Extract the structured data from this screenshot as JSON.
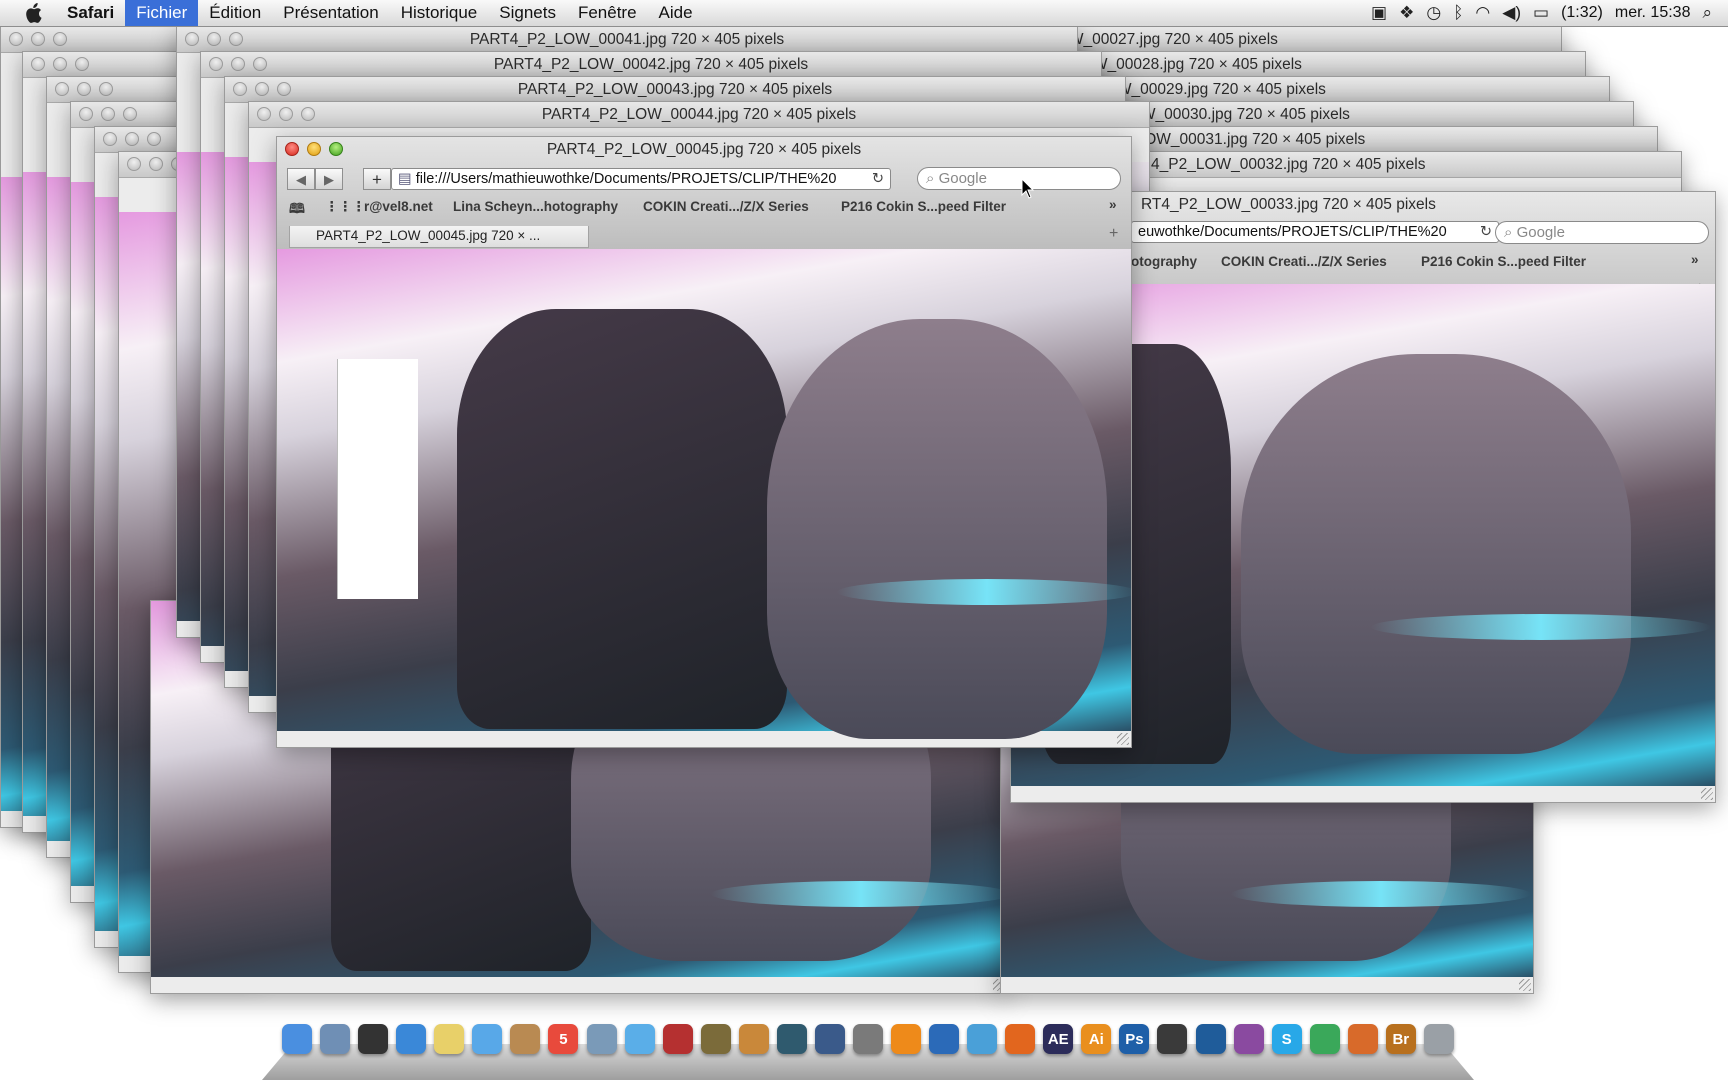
{
  "menubar": {
    "app_name": "Safari",
    "items": [
      "Fichier",
      "Édition",
      "Présentation",
      "Historique",
      "Signets",
      "Fenêtre",
      "Aide"
    ],
    "battery": "(1:32)",
    "clock": "mer. 15:38"
  },
  "windows": {
    "back_left": [
      "PART4_P2_LOW_00041.jpg 720 × 405 pixels",
      "PART4_P2_LOW_00042.jpg 720 × 405 pixels",
      "PART4_P2_LOW_00043.jpg 720 × 405 pixels",
      "PART4_P2_LOW_00044.jpg 720 × 405 pixels"
    ],
    "back_right": [
      "2_LOW_00027.jpg 720 × 405 pixels",
      "2_LOW_00028.jpg 720 × 405 pixels",
      "2_LOW_00029.jpg 720 × 405 pixels",
      "2_LOW_00030.jpg 720 × 405 pixels",
      "_LOW_00031.jpg 720 × 405 pixels",
      "4_P2_LOW_00032.jpg 720 × 405 pixels",
      "RT4_P2_LOW_00033.jpg 720 × 405 pixels"
    ]
  },
  "front": {
    "title": "PART4_P2_LOW_00045.jpg 720 × 405 pixels",
    "url": "file:///Users/mathieuwothke/Documents/PROJETS/CLIP/THE%20",
    "search_placeholder": "Google",
    "bookmarks": [
      "r@vel8.net",
      "Lina Scheyn...hotography",
      "COKIN Creati.../Z/X Series",
      "P216 Cokin S...peed Filter"
    ],
    "tab_label": "PART4_P2_LOW_00045.jpg 720 × ...",
    "more": "»"
  },
  "right_window": {
    "url": "euwothke/Documents/PROJETS/CLIP/THE%20",
    "search_placeholder": "Google",
    "bookmarks": [
      "otography",
      "COKIN Creati.../Z/X Series",
      "P216 Cokin S...peed Filter"
    ],
    "tab_label": "..."
  },
  "dock": {
    "icons": [
      {
        "name": "finder-icon",
        "label": "",
        "color": "#4a8fe0"
      },
      {
        "name": "mail-icon",
        "label": "",
        "color": "#6f8fb5"
      },
      {
        "name": "dashboard-icon",
        "label": "",
        "color": "#333333"
      },
      {
        "name": "safari-icon",
        "label": "",
        "color": "#3a88d8"
      },
      {
        "name": "notes-icon",
        "label": "",
        "color": "#e8d069"
      },
      {
        "name": "ichat-icon",
        "label": "",
        "color": "#58a8e8"
      },
      {
        "name": "address-book-icon",
        "label": "",
        "color": "#b98a52"
      },
      {
        "name": "ical-icon",
        "label": "5",
        "color": "#e84a3c"
      },
      {
        "name": "iphoto-icon",
        "label": "",
        "color": "#7a9ab8"
      },
      {
        "name": "itunes-icon",
        "label": "",
        "color": "#5aaee8"
      },
      {
        "name": "photo-booth-icon",
        "label": "",
        "color": "#b53030"
      },
      {
        "name": "imovie-icon",
        "label": "",
        "color": "#7b6b3a"
      },
      {
        "name": "garageband-icon",
        "label": "",
        "color": "#c9883a"
      },
      {
        "name": "time-machine-icon",
        "label": "",
        "color": "#2f5a6e"
      },
      {
        "name": "spaces-icon",
        "label": "",
        "color": "#3a5a8a"
      },
      {
        "name": "system-preferences-icon",
        "label": "",
        "color": "#7a7a7a"
      },
      {
        "name": "vlc-icon",
        "label": "",
        "color": "#ee8a1a"
      },
      {
        "name": "cyberduck-icon",
        "label": "",
        "color": "#2b6ab8"
      },
      {
        "name": "adium-icon",
        "label": "",
        "color": "#4aa0d8"
      },
      {
        "name": "firefox-icon",
        "label": "",
        "color": "#e2661e"
      },
      {
        "name": "after-effects-icon",
        "label": "AE",
        "color": "#2c2c5a"
      },
      {
        "name": "illustrator-icon",
        "label": "Ai",
        "color": "#e98f1e"
      },
      {
        "name": "photoshop-icon",
        "label": "Ps",
        "color": "#1e5fa8"
      },
      {
        "name": "final-cut-icon",
        "label": "",
        "color": "#3a3a3a"
      },
      {
        "name": "quicktime-icon",
        "label": "",
        "color": "#1f5c9a"
      },
      {
        "name": "video-app-icon",
        "label": "",
        "color": "#8a4aa0"
      },
      {
        "name": "skype-icon",
        "label": "S",
        "color": "#28a8e8"
      },
      {
        "name": "chrome-icon",
        "label": "",
        "color": "#3aa85a"
      },
      {
        "name": "keynote-icon",
        "label": "",
        "color": "#d86a2a"
      },
      {
        "name": "bridge-icon",
        "label": "Br",
        "color": "#b8701e"
      },
      {
        "name": "trash-icon",
        "label": "",
        "color": "#9aa0a6"
      }
    ]
  }
}
